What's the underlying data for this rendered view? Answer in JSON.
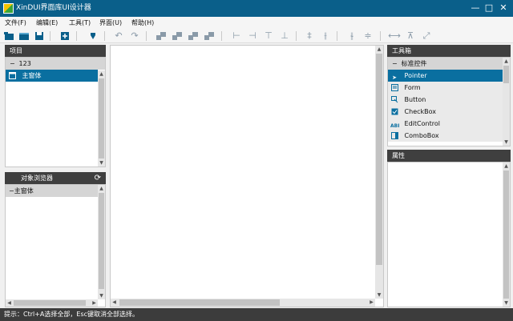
{
  "window": {
    "title": "XinDUI界面库UI设计器",
    "minimize": "—",
    "maximize": "□",
    "close": "✕"
  },
  "menu": [
    {
      "label": "文件(F)"
    },
    {
      "label": "编辑(E)"
    },
    {
      "label": "工具(T)"
    },
    {
      "label": "界面(U)"
    },
    {
      "label": "帮助(H)"
    }
  ],
  "toolbar": {
    "icons": [
      "new-project-icon",
      "open-icon",
      "save-icon",
      "add-form-icon",
      "run-icon",
      "undo-icon",
      "redo-icon",
      "align-left-icon",
      "align-right-icon",
      "align-top-icon",
      "align-bottom-icon",
      "same-left-icon",
      "same-right-icon",
      "same-top-icon",
      "same-bottom-icon",
      "center-vertical-icon",
      "center-horizontal-icon",
      "space-horizontal-icon",
      "space-vertical-icon",
      "same-width-icon",
      "same-height-icon",
      "fullscreen-icon"
    ]
  },
  "project_panel": {
    "title": "项目",
    "group": {
      "expander": "−",
      "label": "123"
    },
    "items": [
      {
        "label": "主窗体"
      }
    ]
  },
  "object_browser": {
    "title": "对象浏览器",
    "refresh_icon": "refresh-icon",
    "items": [
      {
        "label": "−主窗体"
      }
    ]
  },
  "toolbox": {
    "title": "工具箱",
    "group": {
      "expander": "−",
      "label": "标准控件"
    },
    "items": [
      {
        "label": "Pointer",
        "icon": "pointer-icon",
        "selected": true
      },
      {
        "label": "Form",
        "icon": "form-icon"
      },
      {
        "label": "Button",
        "icon": "button-icon"
      },
      {
        "label": "CheckBox",
        "icon": "checkbox-icon"
      },
      {
        "label": "EditControl",
        "icon": "edit-control-icon"
      },
      {
        "label": "ComboBox",
        "icon": "combobox-icon"
      }
    ]
  },
  "properties": {
    "title": "属性"
  },
  "colors": {
    "accent": "#0a5f8a",
    "selection": "#0a6fa0",
    "header": "#3f3f3f",
    "statusbar": "#3c3c3c"
  },
  "status": {
    "text": "提示：Ctrl+A选择全部，Esc键取消全部选择。"
  }
}
